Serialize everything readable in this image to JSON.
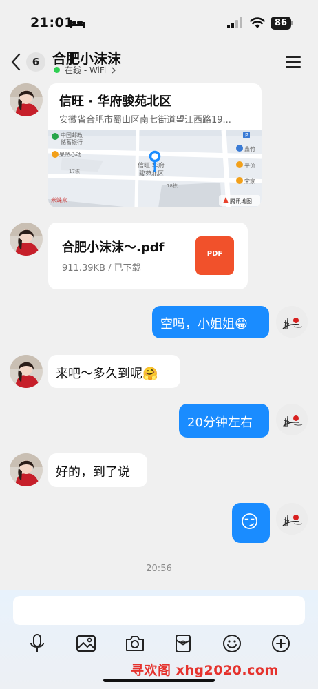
{
  "status_bar": {
    "time": "21:01",
    "battery": "86"
  },
  "header": {
    "unread_count": "6",
    "title": "合肥小沫沫",
    "status": "在线 - WiFi"
  },
  "messages": {
    "location": {
      "name": "信旺 · 华府骏苑北区",
      "address": "安徽省合肥市蜀山区南七街道望江西路19...",
      "map_labels": {
        "bank": "中国邮政\n储蓄银行",
        "xinwang": "信旺 华府",
        "junyuan": "骏苑北区",
        "building18": "18栋",
        "building17": "17栋",
        "xinzhu": "鑫竹",
        "pingjia": "平价",
        "songjia": "宋家",
        "guojiaxindong": "果然心动",
        "midu": "米蝶来",
        "provider": "腾讯地图"
      }
    },
    "file": {
      "name": "合肥小沫沫～.pdf",
      "meta": "911.39KB / 已下载",
      "icon_label": "PDF"
    },
    "msg1": {
      "text": "空吗，小姐姐",
      "emoji": "😁"
    },
    "msg2": {
      "text": "来吧～多久到呢",
      "emoji": "🤗"
    },
    "msg3": {
      "text": "20分钟左右"
    },
    "msg4": {
      "text": "好的，到了说"
    },
    "msg5": {
      "emoji": "😏"
    },
    "timestamp": "20:56"
  },
  "input": {
    "placeholder": ""
  },
  "toolbar": [
    "microphone-icon",
    "image-icon",
    "camera-icon",
    "red-packet-icon",
    "emoji-icon",
    "plus-icon"
  ],
  "watermark": "寻欢阁 xhg2020.com",
  "colors": {
    "accent": "#1a8cff",
    "online": "#2fcf52",
    "pdf": "#f1512b",
    "watermark": "#e5322d"
  }
}
